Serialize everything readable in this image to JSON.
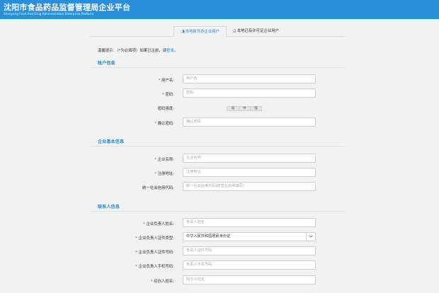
{
  "header": {
    "title": "沈阳市食品药品监督管理局企业平台",
    "subtitle": "Shenyang Food And Drug Administration Enterprise Platform",
    "bg_color": "#2a8fd9"
  },
  "tabs": [
    {
      "label": "本地新开办企业用户",
      "icon": "users-icon",
      "active": true
    },
    {
      "label": "本地已有许可证企业用户",
      "icon": "user-icon",
      "active": false
    }
  ],
  "notice": {
    "prefix": "温馨提示：（*为必填项）如果已注册，请",
    "link": "登录",
    "suffix": "。"
  },
  "sections": {
    "account": {
      "title": "账户信息"
    },
    "company": {
      "title": "企业基本信息"
    },
    "contact": {
      "title": "联系人信息"
    }
  },
  "account_fields": {
    "username": {
      "label": "用户名:",
      "placeholder": "用户名",
      "required": true
    },
    "password": {
      "label": "密码:",
      "placeholder": "密码",
      "required": true
    },
    "strength": {
      "label": "密码强度:",
      "levels": [
        "弱",
        "中",
        "强"
      ]
    },
    "confirm": {
      "label": "确认密码:",
      "placeholder": "确认密码",
      "required": true
    }
  },
  "company_fields": {
    "name": {
      "label": "企业名称:",
      "placeholder": "企业名称",
      "required": true
    },
    "address": {
      "label": "注册地址:",
      "placeholder": "注册地址",
      "required": true
    },
    "credit_code": {
      "label": "统一社会信用代码:",
      "placeholder": "统一社会信用代码(按营业执照填写)",
      "required": false
    }
  },
  "contact_fields": {
    "manager_name": {
      "label": "企业负责人姓名:",
      "placeholder": "负责人姓名",
      "required": true
    },
    "manager_id_type": {
      "label": "企业负责人证件类型:",
      "value": "中华人民共和国居民身份证",
      "required": true
    },
    "manager_id_no": {
      "label": "企业负责人证件号码:",
      "placeholder": "负责人证件号码",
      "required": true
    },
    "manager_phone": {
      "label": "企业负责人手机号码:",
      "placeholder": "负责人手机号码",
      "required": true
    },
    "agent_name": {
      "label": "经办人姓名:",
      "placeholder": "经办人姓名",
      "required": true
    }
  },
  "req_mark": "*"
}
